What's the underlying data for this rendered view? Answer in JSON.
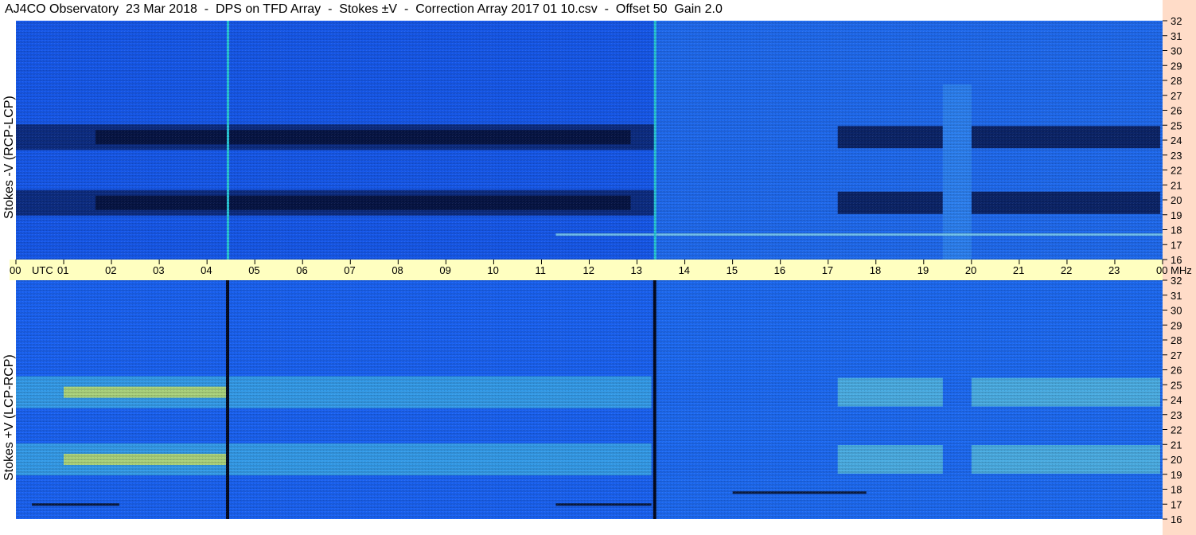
{
  "title": "AJ4CO Observatory  23 Mar 2018  -  DPS on TFD Array  -  Stokes ±V  -  Correction Array 2017 01 10.csv  -  Offset 50  Gain 2.0",
  "chart_data": [
    {
      "type": "heatmap",
      "name": "upper",
      "ylabel": "Stokes -V (RCP-LCP)",
      "y_ticks": [
        "16",
        "17",
        "18",
        "19",
        "20",
        "21",
        "22",
        "23",
        "24",
        "25",
        "26",
        "27",
        "28",
        "29",
        "30",
        "31",
        "32"
      ],
      "y_unit": "MHz",
      "ylim": [
        16,
        32
      ],
      "xlim": [
        0,
        24
      ],
      "vertical_lines_utc": [
        4.43,
        13.37
      ],
      "dark_bands_mhz": [
        24.2,
        19.8
      ]
    },
    {
      "type": "heatmap",
      "name": "lower",
      "ylabel": "Stokes +V (LCP-RCP)",
      "y_ticks": [
        "16",
        "17",
        "18",
        "19",
        "20",
        "21",
        "22",
        "23",
        "24",
        "25",
        "26",
        "27",
        "28",
        "29",
        "30",
        "31",
        "32"
      ],
      "y_unit": "MHz",
      "ylim": [
        16,
        32
      ],
      "xlim": [
        0,
        24
      ],
      "vertical_lines_utc": [
        4.43,
        13.37
      ],
      "bright_bands_mhz": [
        24.5,
        20.0
      ]
    }
  ],
  "time_axis": {
    "labels": [
      "00",
      "01",
      "02",
      "03",
      "04",
      "05",
      "06",
      "07",
      "08",
      "09",
      "10",
      "11",
      "12",
      "13",
      "14",
      "15",
      "16",
      "17",
      "18",
      "19",
      "20",
      "21",
      "22",
      "23",
      "00"
    ],
    "utc_label": "UTC",
    "unit_label": "MHz"
  },
  "colors": {
    "background": "#1a5cf0",
    "dark": "#05123a",
    "bright": "#e8e040",
    "band": "#ffffc0",
    "right_strip": "#ffdcc8"
  }
}
